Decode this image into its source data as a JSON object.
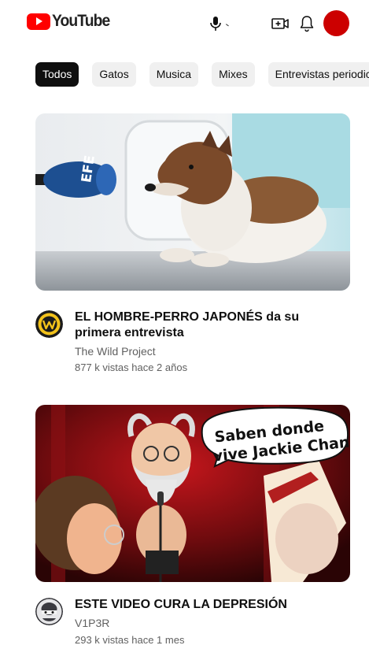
{
  "header": {
    "logo_text": "YouTube",
    "icons": [
      "microphone-icon",
      "create-video-icon",
      "notifications-bell-icon"
    ],
    "avatar_color": "#cc0000"
  },
  "chips": [
    {
      "label": "Todos",
      "active": true
    },
    {
      "label": "Gatos",
      "active": false
    },
    {
      "label": "Musica",
      "active": false
    },
    {
      "label": "Mixes",
      "active": false
    },
    {
      "label": "Entrevistas periodicas",
      "active": false
    }
  ],
  "videos": [
    {
      "title": "EL HOMBRE-PERRO JAPONÉS da su primera entrevista",
      "channel": "The Wild Project",
      "stats": "877 k vistas hace 2 años",
      "thumbnail": {
        "subject": "collie-dog-costume",
        "microphone_brand": "EFE"
      }
    },
    {
      "title": "ESTE VIDEO CURA LA DEPRESIÓN",
      "channel": "V1P3R",
      "stats": "293 k vistas hace 1 mes",
      "thumbnail": {
        "subject": "cartoon-old-man-microphone",
        "bubble_line1": "Saben donde",
        "bubble_line2": "vive Jackie Chan?"
      }
    }
  ],
  "colors": {
    "brand_red": "#ff0000",
    "chip_active_bg": "#0f0f0f",
    "chip_bg": "#f0f0f0",
    "secondary_text": "#606060"
  }
}
